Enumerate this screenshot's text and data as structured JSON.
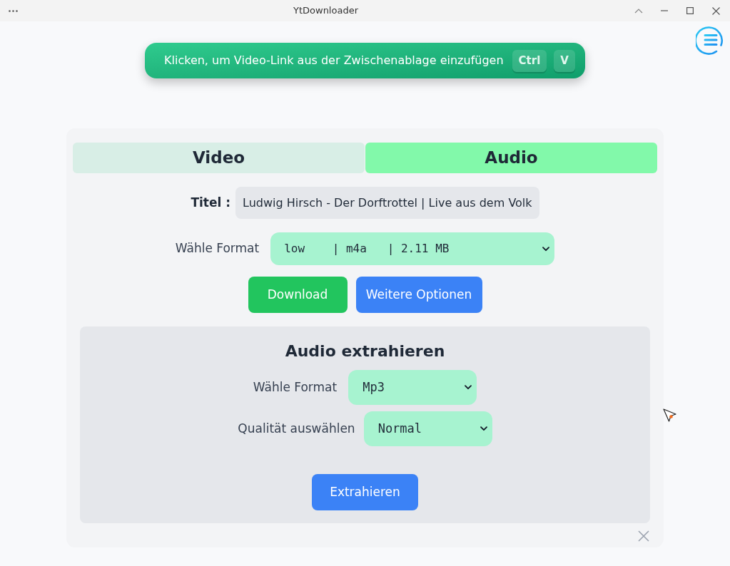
{
  "window": {
    "title": "YtDownloader"
  },
  "paste_button": {
    "label": "Klicken, um Video-Link aus der Zwischenablage einzufügen",
    "keys": [
      "Ctrl",
      "V"
    ]
  },
  "tabs": [
    {
      "label": "Video",
      "selected": false
    },
    {
      "label": "Audio",
      "selected": true
    }
  ],
  "title_field": {
    "label": "Titel :",
    "value": "Ludwig Hirsch - Der Dorftrottel | Live aus dem Volk"
  },
  "format_select": {
    "label": "Wähle Format",
    "value": "low    | m4a   | 2.11 MB"
  },
  "buttons": [
    {
      "label": "Download",
      "kind": "download"
    },
    {
      "label": "Weitere Optionen",
      "kind": "options"
    }
  ],
  "extract_panel": {
    "title": "Audio extrahieren",
    "fields": [
      {
        "label": "Wähle Format",
        "value": "Mp3"
      },
      {
        "label": "Qualität auswählen",
        "value": "Normal"
      }
    ],
    "button": {
      "label": "Extrahieren",
      "kind": "extract"
    }
  }
}
